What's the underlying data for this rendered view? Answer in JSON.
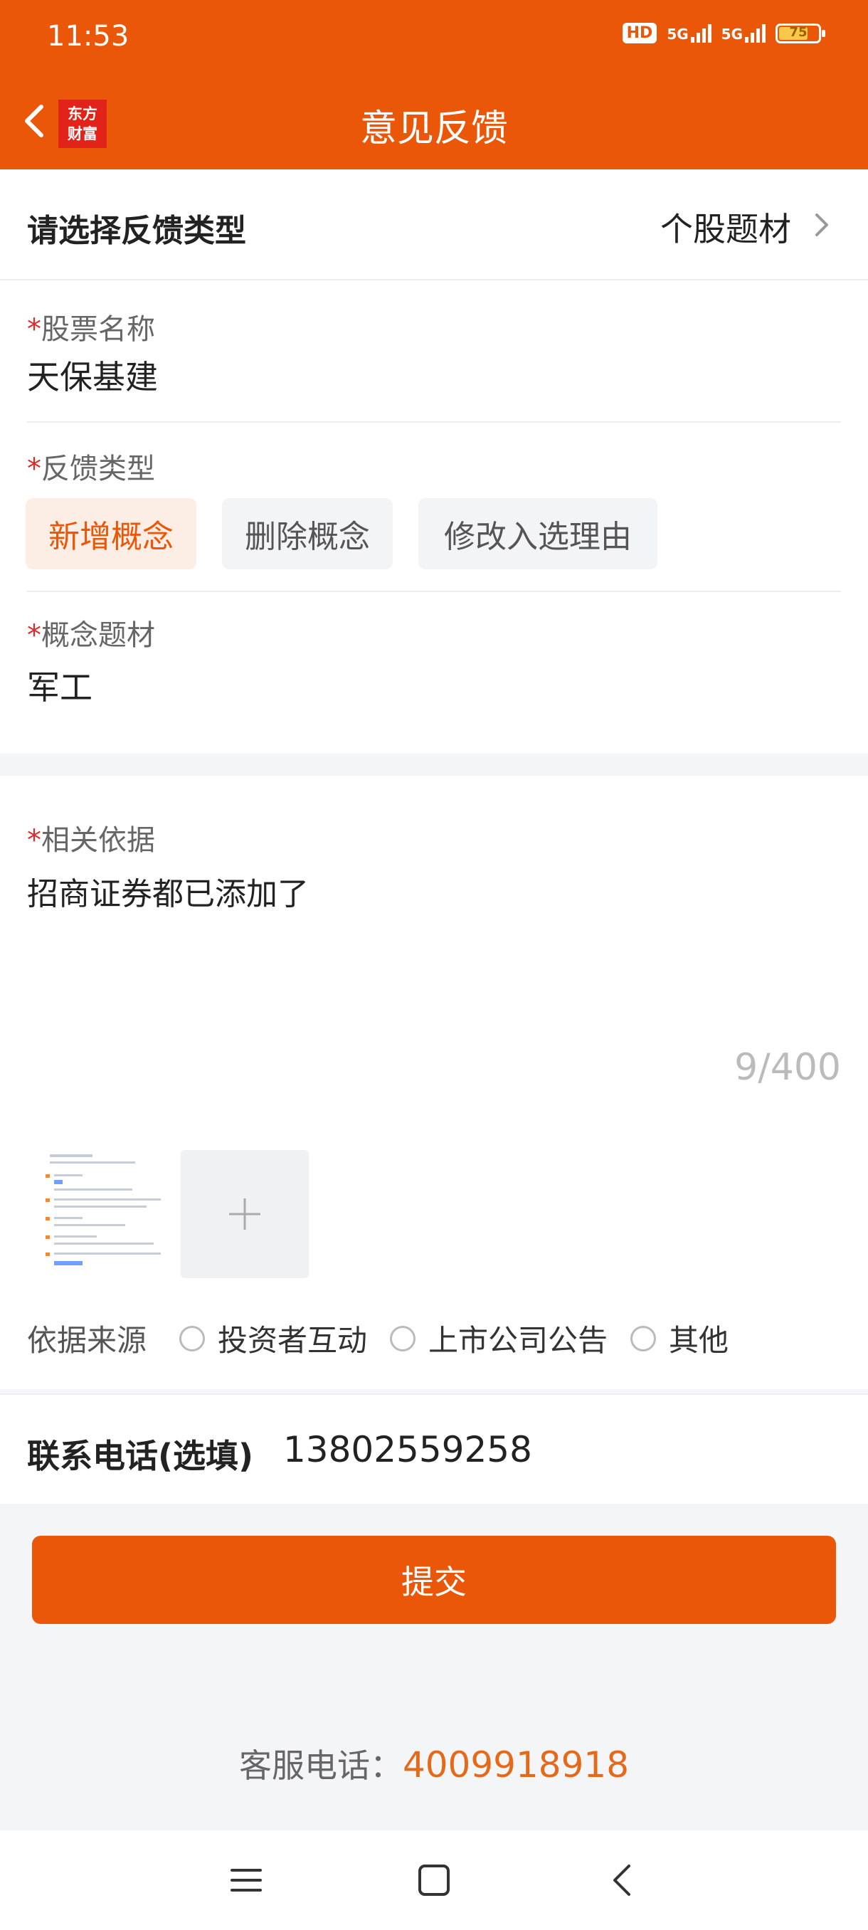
{
  "status_bar": {
    "time": "11:53",
    "hd_label": "HD",
    "network_1": "5G",
    "network_2": "5G",
    "battery": "75",
    "battery_level": 0.75
  },
  "nav": {
    "logo_line1": "东方",
    "logo_line2": "财富",
    "title": "意见反馈"
  },
  "feedback_type_row": {
    "label": "请选择反馈类型",
    "value": "个股题材"
  },
  "stock_name": {
    "label": "股票名称",
    "value": "天保基建"
  },
  "feedback_kind": {
    "label": "反馈类型",
    "options": [
      "新增概念",
      "删除概念",
      "修改入选理由"
    ],
    "selected": "新增概念"
  },
  "concept": {
    "label": "概念题材",
    "value": "军工"
  },
  "basis": {
    "label": "相关依据",
    "text": "招商证券都已添加了",
    "counter": "9/400"
  },
  "source": {
    "label": "依据来源",
    "options": [
      "投资者互动",
      "上市公司公告",
      "其他"
    ]
  },
  "phone": {
    "label": "联系电话(选填)",
    "value": "13802559258"
  },
  "submit_label": "提交",
  "service": {
    "label": "客服电话：",
    "number": "4009918918"
  },
  "required_mark": "*",
  "colors": {
    "brand": "#eb5709",
    "chip_active_bg": "#fdeee5",
    "required": "#e02a2a"
  }
}
